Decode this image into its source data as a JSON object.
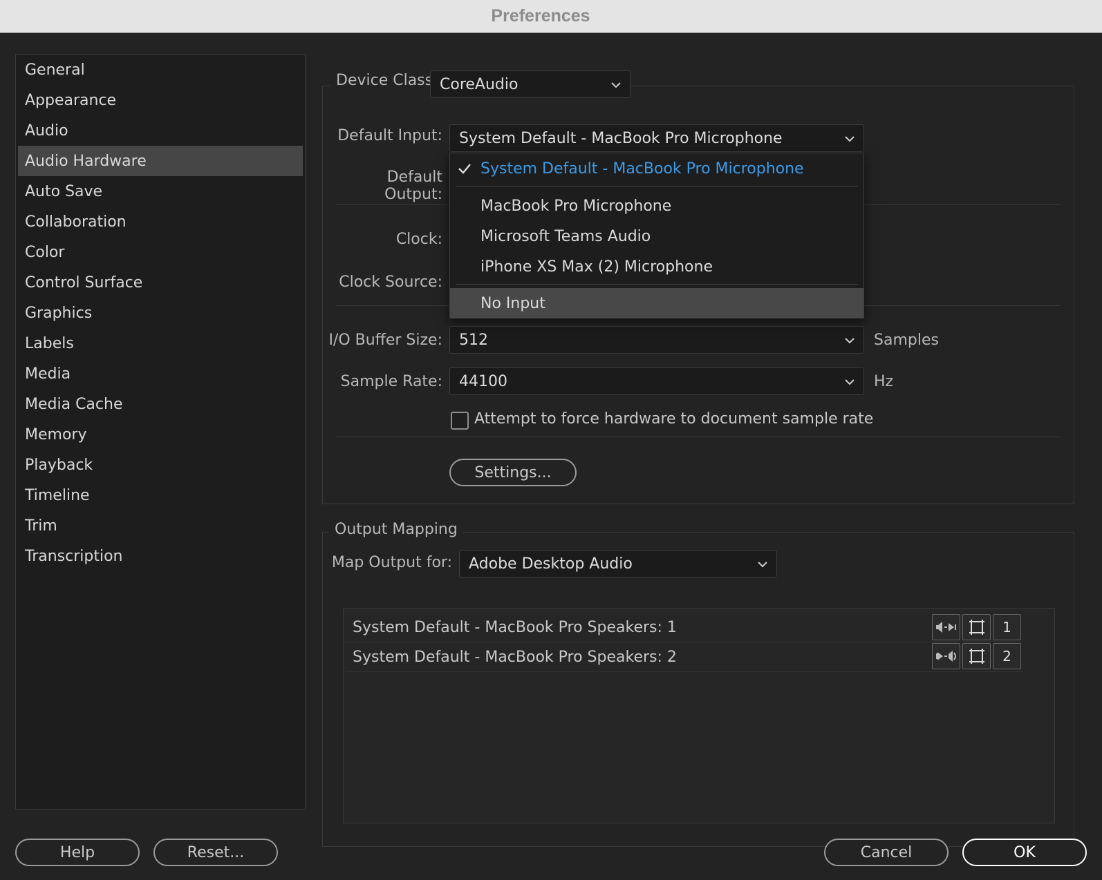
{
  "window": {
    "title": "Preferences"
  },
  "sidebar": {
    "items": [
      {
        "label": "General"
      },
      {
        "label": "Appearance"
      },
      {
        "label": "Audio"
      },
      {
        "label": "Audio Hardware",
        "active": true
      },
      {
        "label": "Auto Save"
      },
      {
        "label": "Collaboration"
      },
      {
        "label": "Color"
      },
      {
        "label": "Control Surface"
      },
      {
        "label": "Graphics"
      },
      {
        "label": "Labels"
      },
      {
        "label": "Media"
      },
      {
        "label": "Media Cache"
      },
      {
        "label": "Memory"
      },
      {
        "label": "Playback"
      },
      {
        "label": "Timeline"
      },
      {
        "label": "Trim"
      },
      {
        "label": "Transcription"
      }
    ]
  },
  "hardware": {
    "device_class_label": "Device Class:",
    "device_class_value": "CoreAudio",
    "default_input_label": "Default Input:",
    "default_input_value": "System Default - MacBook Pro Microphone",
    "default_output_label": "Default Output:",
    "clock_label": "Clock:",
    "clock_source_label": "Clock Source:",
    "buffer_label": "I/O Buffer Size:",
    "buffer_value": "512",
    "buffer_unit": "Samples",
    "sample_rate_label": "Sample Rate:",
    "sample_rate_value": "44100",
    "sample_rate_unit": "Hz",
    "force_rate_label": "Attempt to force hardware to document sample rate",
    "force_rate_checked": false,
    "settings_button": "Settings..."
  },
  "input_dropdown": {
    "options": [
      {
        "label": "System Default - MacBook Pro Microphone",
        "selected": true
      },
      {
        "label": "MacBook Pro Microphone"
      },
      {
        "label": "Microsoft Teams Audio"
      },
      {
        "label": "iPhone XS Max (2) Microphone"
      },
      {
        "label": "No Input",
        "hovered": true
      }
    ]
  },
  "output_mapping": {
    "legend": "Output Mapping",
    "map_output_label": "Map Output for:",
    "map_output_value": "Adobe Desktop Audio",
    "rows": [
      {
        "label": "System Default - MacBook Pro Speakers: 1",
        "channel": "1"
      },
      {
        "label": "System Default - MacBook Pro Speakers: 2",
        "channel": "2"
      }
    ]
  },
  "footer": {
    "help": "Help",
    "reset": "Reset...",
    "cancel": "Cancel",
    "ok": "OK"
  },
  "colors": {
    "accent_selected": "#3a9be8",
    "background": "#232323",
    "sidebar_active": "#464646"
  }
}
